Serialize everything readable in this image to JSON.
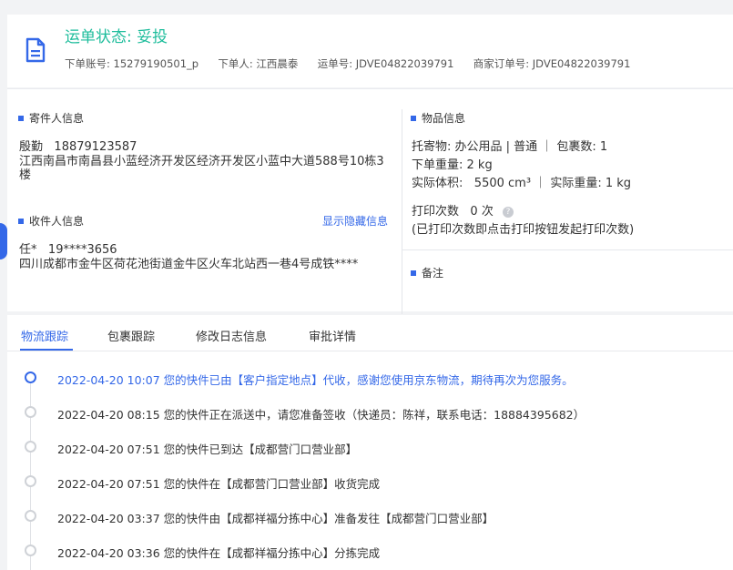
{
  "header": {
    "status": "运单状态: 妥投",
    "account_label": "下单账号:",
    "account_value": "15279190501_p",
    "orderer_label": "下单人:",
    "orderer_value": "江西晨泰",
    "waybill_label": "运单号:",
    "waybill_value": "JDVE04822039791",
    "merchant_label": "商家订单号:",
    "merchant_value": "JDVE04822039791"
  },
  "sender": {
    "title": "寄件人信息",
    "name": "殷勤",
    "phone": "18879123587",
    "address": "江西南昌市南昌县小蓝经济开发区经济开发区小蓝中大道588号10栋3楼"
  },
  "receiver": {
    "title": "收件人信息",
    "toggle_link": "显示隐藏信息",
    "name": "任*",
    "phone": "19****3656",
    "address": "四川成都市金牛区荷花池街道金牛区火车北站西一巷4号成铁****"
  },
  "item": {
    "title": "物品信息",
    "line1": "托寄物:  办公用品 | 普通 ｜ 包裹数:  1",
    "line2": "下单重量:  2 kg",
    "volume_label": "实际体积:",
    "volume_value": "5500 cm³",
    "weight_text": "｜ 实际重量:   1 kg",
    "print_label": "打印次数",
    "print_value": "0 次",
    "print_note": "(已打印次数即点击打印按钮发起打印次数)"
  },
  "remark": {
    "title": "备注"
  },
  "tabs": [
    "物流跟踪",
    "包裹跟踪",
    "修改日志信息",
    "审批详情"
  ],
  "timeline": [
    "2022-04-20 10:07 您的快件已由【客户指定地点】代收，感谢您使用京东物流，期待再次为您服务。",
    "2022-04-20 08:15 您的快件正在派送中，请您准备签收（快递员：陈祥，联系电话：18884395682）",
    "2022-04-20 07:51 您的快件已到达【成都营门口营业部】",
    "2022-04-20 07:51 您的快件在【成都营门口营业部】收货完成",
    "2022-04-20 03:37 您的快件由【成都祥福分拣中心】准备发往【成都营门口营业部】",
    "2022-04-20 03:36 您的快件在【成都祥福分拣中心】分拣完成"
  ],
  "colors": {
    "status_green": "#1fbd9c",
    "accent_blue": "#3468e8"
  }
}
